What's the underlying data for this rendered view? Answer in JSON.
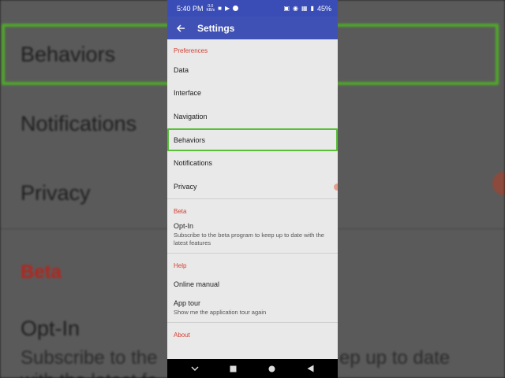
{
  "status_bar": {
    "time": "5:40 PM",
    "speed": "0.0",
    "speed_unit": "KB/s",
    "battery": "45%"
  },
  "app_bar": {
    "title": "Settings"
  },
  "sections": [
    {
      "header": "Preferences",
      "items": [
        {
          "label": "Data"
        },
        {
          "label": "Interface"
        },
        {
          "label": "Navigation"
        },
        {
          "label": "Behaviors",
          "highlighted": true
        },
        {
          "label": "Notifications"
        },
        {
          "label": "Privacy"
        }
      ]
    },
    {
      "header": "Beta",
      "items": [
        {
          "label": "Opt-In",
          "summary": "Subscribe to the beta program to keep up to date with the latest features"
        }
      ]
    },
    {
      "header": "Help",
      "items": [
        {
          "label": "Online manual"
        },
        {
          "label": "App tour",
          "summary": "Show me the application tour again"
        }
      ]
    },
    {
      "header": "About"
    }
  ],
  "background_zoom": {
    "behaviors": "Behaviors",
    "notifications": "Notifications",
    "privacy": "Privacy",
    "beta": "Beta",
    "optin": "Opt-In",
    "sub_left": "Subscribe to the",
    "sub_right": "ep up to date",
    "sub2_left": "with the latest fe"
  },
  "colors": {
    "app_bar": "#3f51b5",
    "category_accent": "#d23f31",
    "highlight": "#5bbf3a"
  }
}
